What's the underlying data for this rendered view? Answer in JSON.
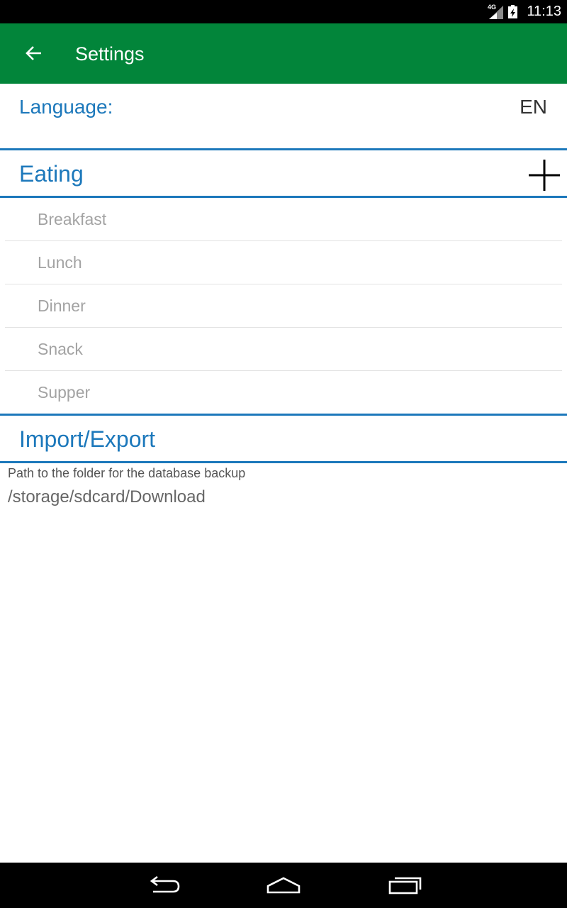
{
  "status_bar": {
    "network": "4G",
    "time": "11:13",
    "icons": [
      "signal-icon",
      "battery-icon"
    ]
  },
  "app_bar": {
    "title": "Settings",
    "back_icon": "arrow-back-icon",
    "background_color": "#02853a"
  },
  "language": {
    "label": "Language:",
    "value": "EN"
  },
  "eating": {
    "title": "Eating",
    "add_icon": "plus-icon",
    "items": [
      {
        "label": "Breakfast"
      },
      {
        "label": "Lunch"
      },
      {
        "label": "Dinner"
      },
      {
        "label": "Snack"
      },
      {
        "label": "Supper"
      }
    ]
  },
  "import_export": {
    "title": "Import/Export",
    "caption": "Path to the folder for the database backup",
    "path": "/storage/sdcard/Download"
  },
  "nav_bar": {
    "icons": [
      "back-icon",
      "home-icon",
      "recents-icon"
    ]
  },
  "colors": {
    "accent": "#1c78bb",
    "list_text": "#a3a3a3",
    "divider": "#e2e2e2"
  }
}
